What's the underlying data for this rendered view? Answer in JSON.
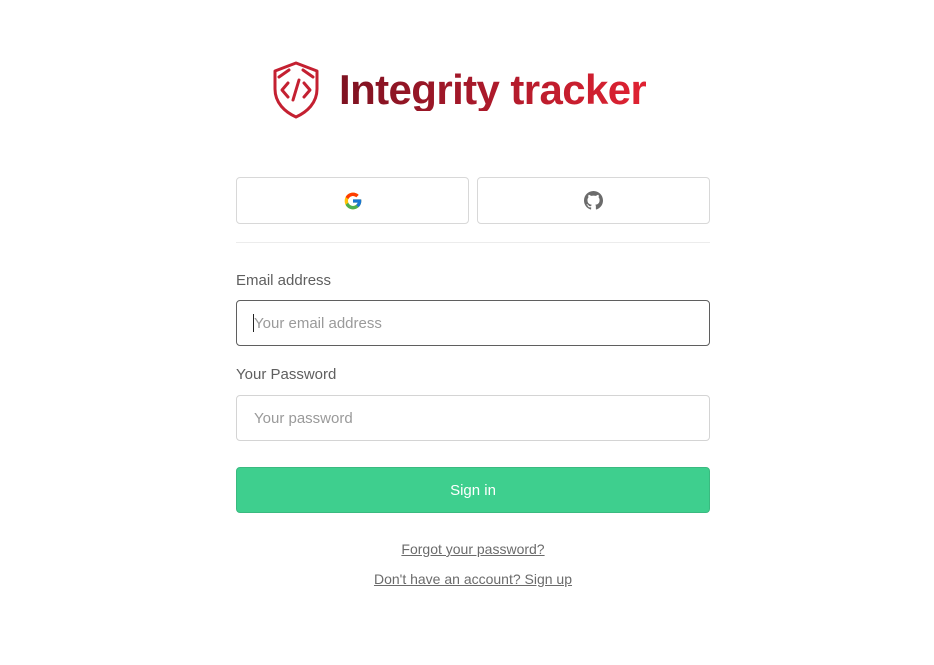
{
  "brand": {
    "title": "Integrity tracker",
    "logo_icon": "shield-code-icon",
    "colors": {
      "dark": "#7e1221",
      "mid": "#a8192a",
      "bright": "#e02232"
    }
  },
  "oauth": {
    "providers": [
      {
        "name": "Google",
        "icon": "google-icon"
      },
      {
        "name": "GitHub",
        "icon": "github-icon"
      }
    ]
  },
  "form": {
    "email": {
      "label": "Email address",
      "placeholder": "Your email address",
      "value": ""
    },
    "password": {
      "label": "Your Password",
      "placeholder": "Your password",
      "value": ""
    },
    "submit_label": "Sign in",
    "submit_color": "#3ecf8e"
  },
  "links": {
    "forgot_password": "Forgot your password?",
    "sign_up": "Don't have an account? Sign up"
  }
}
